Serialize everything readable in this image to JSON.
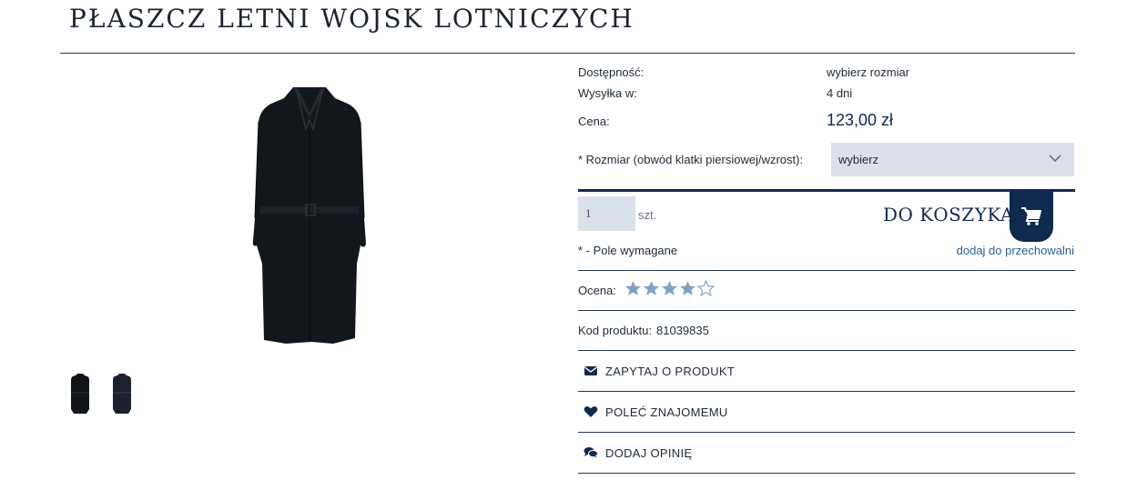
{
  "product": {
    "title": "PŁASZCZ LETNI WOJSK LOTNICZYCH",
    "availability_label": "Dostępność:",
    "availability_value": "wybierz rozmiar",
    "shipping_label": "Wysyłka w:",
    "shipping_value": "4 dni",
    "price_label": "Cena:",
    "price_value": "123,00 zł",
    "size_label": "* Rozmiar (obwód klatki piersiowej/wzrost):",
    "size_selected": "wybierz",
    "quantity_value": "1",
    "quantity_unit": "szt.",
    "add_to_cart_label": "DO KOSZYKA",
    "required_note": "* - Pole wymagane",
    "wishlist_label": "dodaj do przechowalni",
    "rating_label": "Ocena:",
    "rating_value": 4,
    "rating_max": 5,
    "code_label": "Kod produktu:",
    "code_value": "81039835"
  },
  "actions": [
    {
      "label": "ZAPYTAJ O PRODUKT",
      "icon": "envelope-icon"
    },
    {
      "label": "POLEĆ ZNAJOMEMU",
      "icon": "heart-icon"
    },
    {
      "label": "DODAJ OPINIĘ",
      "icon": "chat-icon"
    }
  ],
  "gallery": {
    "thumbnails": [
      "coat-thumbnail-1",
      "coat-thumbnail-2"
    ]
  },
  "colors": {
    "navy": "#0e2a4f",
    "select_bg": "#d9e2ea",
    "star_filled": "#7fa3c4",
    "link": "#2b5f8c"
  }
}
